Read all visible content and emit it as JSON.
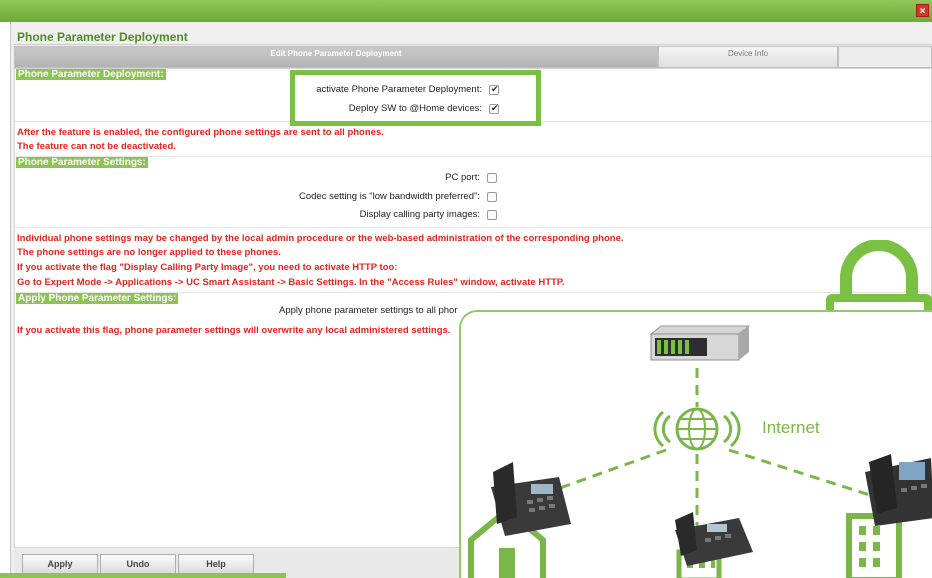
{
  "window": {
    "title": "Phone Parameter Deployment",
    "close_symbol": "×"
  },
  "tabs": [
    {
      "label": "Edit Phone Parameter Deployment",
      "active": true
    },
    {
      "label": "Device Info",
      "active": false
    }
  ],
  "sections": {
    "deployment": {
      "header": "Phone Parameter Deployment:",
      "fields": [
        {
          "label": "activate Phone Parameter Deployment:",
          "checked": true
        },
        {
          "label": "Deploy SW to @Home devices:",
          "checked": true
        }
      ],
      "notes": [
        "After the feature is enabled, the configured phone settings are sent to all phones.",
        "The feature can not be deactivated."
      ]
    },
    "settings": {
      "header": "Phone Parameter Settings:",
      "fields": [
        {
          "label": "PC port:",
          "checked": false
        },
        {
          "label": "Codec setting is \"low bandwidth preferred\":",
          "checked": false
        },
        {
          "label": "Display calling party images:",
          "checked": false
        }
      ],
      "notes": [
        "Individual phone settings may be changed by the local admin procedure or the web-based administration of the corresponding phone.",
        "The phone settings are no longer applied to these phones.",
        "If you activate the flag \"Display Calling Party Image\", you need to activate HTTP too:",
        "Go to Expert Mode -> Applications -> UC Smart Assistant -> Basic Settings. In the \"Access Rules\" window, activate HTTP."
      ]
    },
    "apply": {
      "header": "Apply Phone Parameter Settings:",
      "field": {
        "label": "Apply phone parameter settings to all phor"
      },
      "note": "If you activate this flag, phone parameter settings will overwrite any local administered settings."
    }
  },
  "buttons": {
    "apply": "Apply",
    "undo": "Undo",
    "help": "Help"
  },
  "diagram": {
    "internet_label": "Internet"
  },
  "colors": {
    "accent_green": "#7ac143",
    "header_green": "#8cc450",
    "warning_red": "#e8221c",
    "title_green": "#4f8c24"
  },
  "icons": [
    "close-icon",
    "lock-icon",
    "globe-icon",
    "server-icon",
    "desk-phone-icon",
    "house-icon",
    "office-building-icon",
    "checkbox-icon"
  ]
}
